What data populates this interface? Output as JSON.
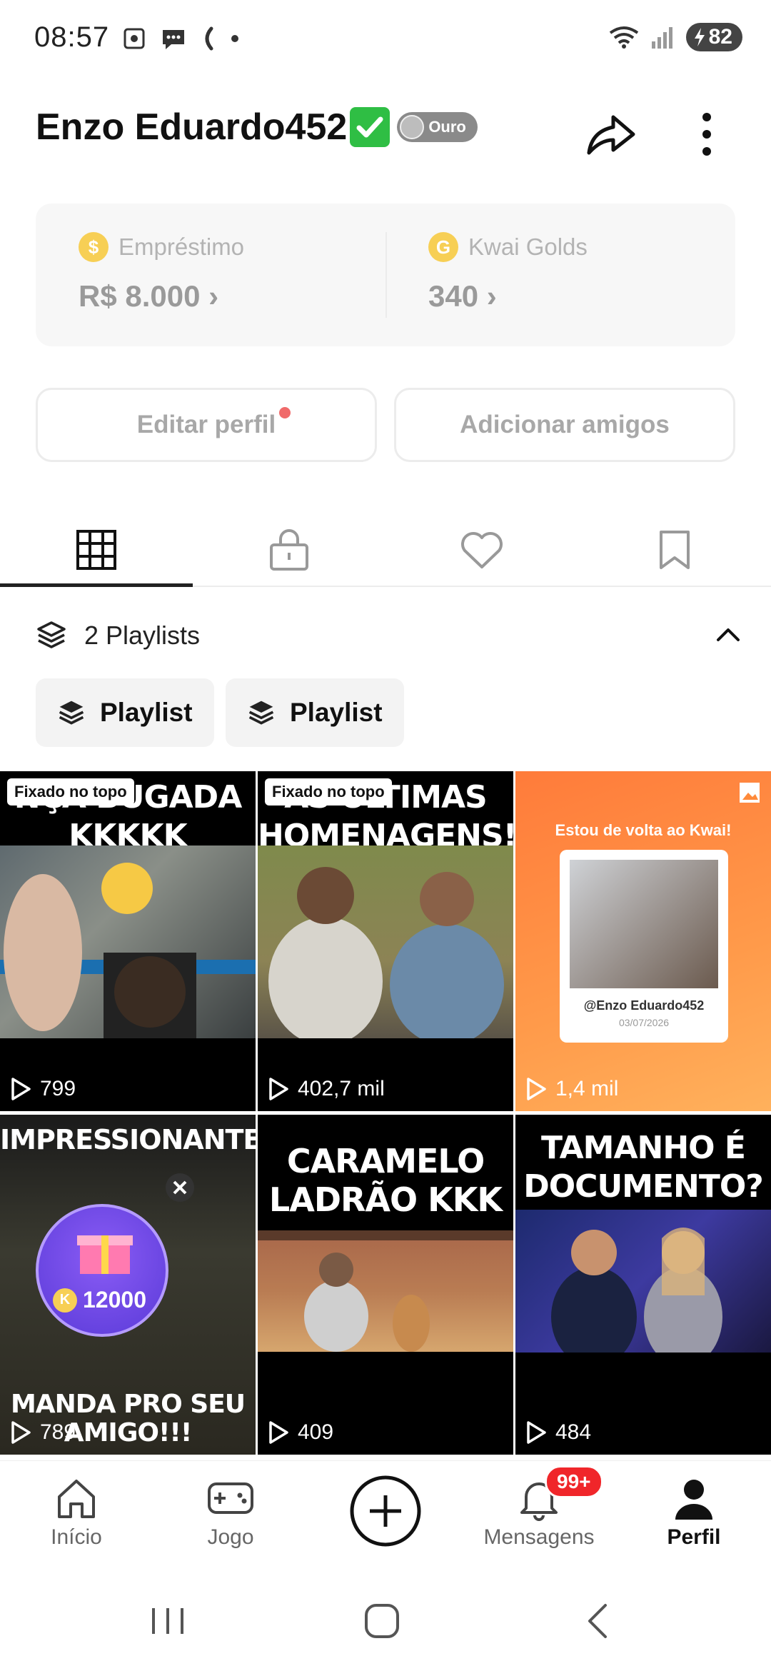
{
  "status_bar": {
    "time": "08:57",
    "battery": "82"
  },
  "header": {
    "username": "Enzo Eduardo452",
    "rank": "Ouro"
  },
  "wallet": {
    "loan": {
      "label": "Empréstimo",
      "value": "R$ 8.000",
      "icon_text": "$"
    },
    "golds": {
      "label": "Kwai Golds",
      "value": "340",
      "icon_text": "G"
    }
  },
  "actions": {
    "edit": "Editar perfil",
    "add_friends": "Adicionar amigos"
  },
  "playlists": {
    "title": "2 Playlists",
    "chips": [
      "Playlist",
      "Playlist"
    ]
  },
  "videos": [
    {
      "title": "NÇA BUGADA KKKKK",
      "pinned": "Fixado no topo",
      "views": "799"
    },
    {
      "title": "AS ÚLTIMAS HOMENAGENS!",
      "pinned": "Fixado no topo",
      "views": "402,7 mil"
    },
    {
      "title": "Estou de volta ao Kwai!",
      "card_user": "@Enzo Eduardo452",
      "card_date": "03/07/2026",
      "views": "1,4 mil"
    },
    {
      "title": "IMPRESSIONANTE",
      "reward": "12000",
      "bottom_title": "MANDA PRO SEU AMIGO!!!",
      "views": "789"
    },
    {
      "title": "CARAMELO LADRÃO KKK",
      "views": "409"
    },
    {
      "title": "TAMANHO É DOCUMENTO?",
      "views": "484"
    }
  ],
  "nav": {
    "home": "Início",
    "game": "Jogo",
    "messages": "Mensagens",
    "messages_badge": "99+",
    "profile": "Perfil"
  }
}
